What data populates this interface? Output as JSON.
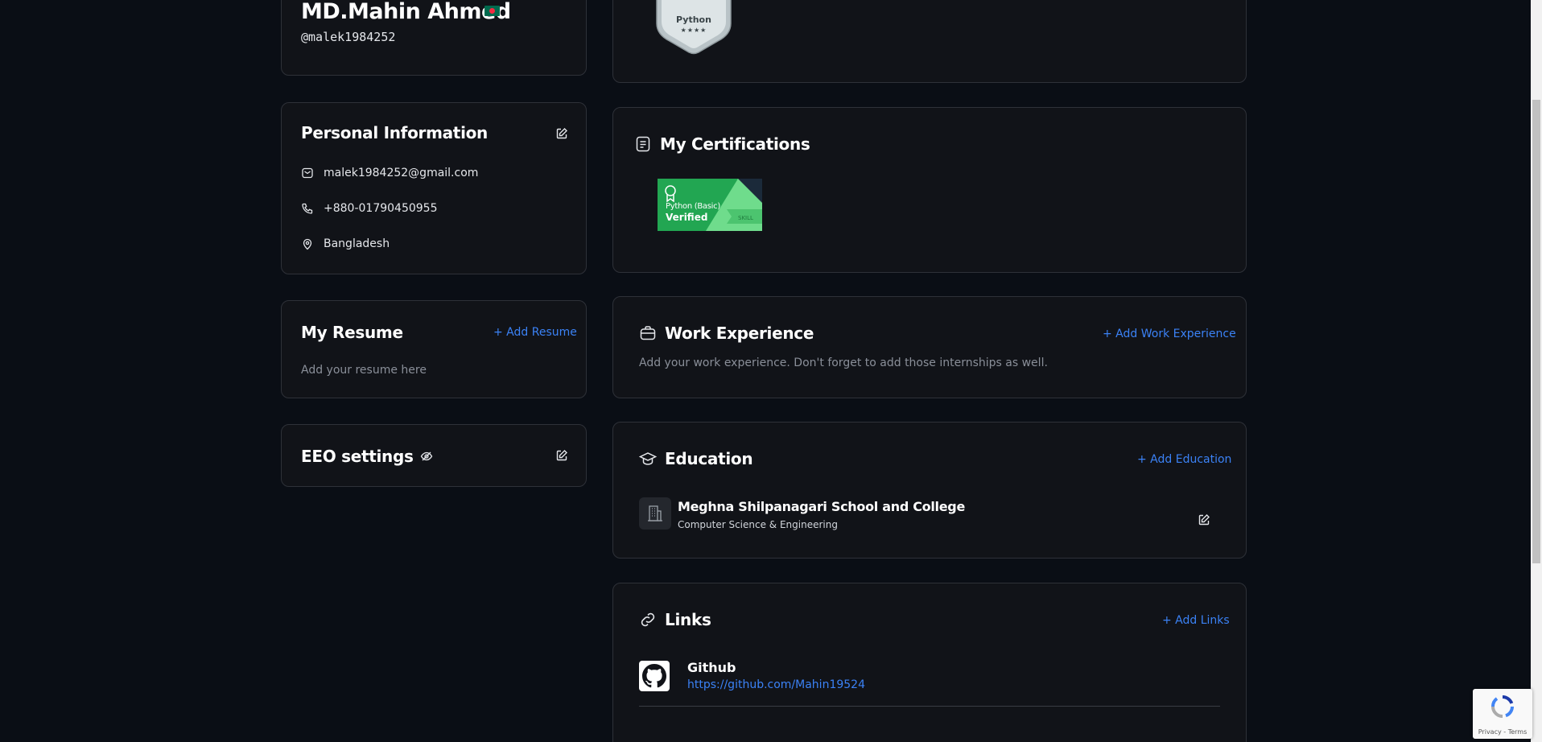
{
  "profile": {
    "name": "MD.Mahin Ahmed",
    "handle": "@malek1984252"
  },
  "badges": {
    "python": {
      "label": "Python",
      "stars": "★★★★"
    }
  },
  "personal": {
    "title": "Personal Information",
    "email": "malek1984252@gmail.com",
    "phone": "+880-01790450955",
    "location": "Bangladesh"
  },
  "resume": {
    "title": "My Resume",
    "add_label": "+ Add Resume",
    "placeholder": "Add your resume here"
  },
  "eeo": {
    "title": "EEO settings"
  },
  "certifications": {
    "title": "My Certifications",
    "items": [
      {
        "line1": "Python (Basic)",
        "line2": "Verified",
        "tag": "SKILL"
      }
    ]
  },
  "work": {
    "title": "Work Experience",
    "add_label": "+ Add Work Experience",
    "placeholder": "Add your work experience. Don't forget to add those internships as well."
  },
  "education": {
    "title": "Education",
    "add_label": "+ Add Education",
    "items": [
      {
        "school": "Meghna Shilpanagari School and College",
        "field": "Computer Science & Engineering"
      }
    ]
  },
  "links": {
    "title": "Links",
    "add_label": "+ Add Links",
    "items": [
      {
        "name": "Github",
        "url": "https://github.com/Mahin19524"
      }
    ]
  },
  "recaptcha": {
    "footer": "Privacy - Terms"
  },
  "colors": {
    "background": "#0a0e15",
    "card": "#111318",
    "accent": "#3b82f6",
    "cert_green": "#22a652"
  }
}
